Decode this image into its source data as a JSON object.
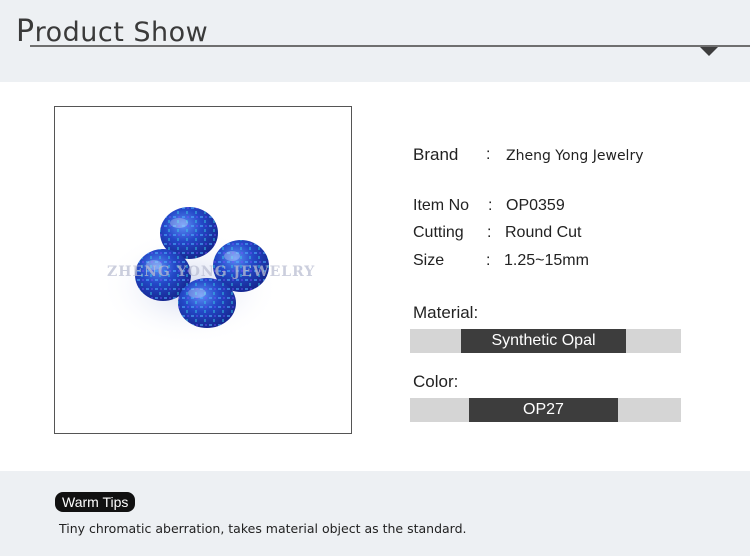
{
  "header": {
    "title_initial": "P",
    "title_rest": "roduct Show",
    "accent_color": "#3d3d3d"
  },
  "image": {
    "watermark": "ZHENG YONG JEWELRY",
    "stone_color": "#2a4fd0"
  },
  "specs": [
    {
      "label": "Brand",
      "colon": ":",
      "value": "Zheng Yong Jewelry"
    },
    {
      "label": "Item No",
      "colon": ":",
      "value": "OP0359"
    },
    {
      "label": "Cutting",
      "colon": ":",
      "value": "Round Cut"
    },
    {
      "label": "Size",
      "colon": ":",
      "value": "1.25~15mm"
    }
  ],
  "material": {
    "label": "Material:",
    "value": "Synthetic Opal"
  },
  "color": {
    "label": "Color:",
    "value": "OP27"
  },
  "footer": {
    "badge": "Warm Tips",
    "text": "Tiny chromatic aberration, takes material object as the standard."
  }
}
